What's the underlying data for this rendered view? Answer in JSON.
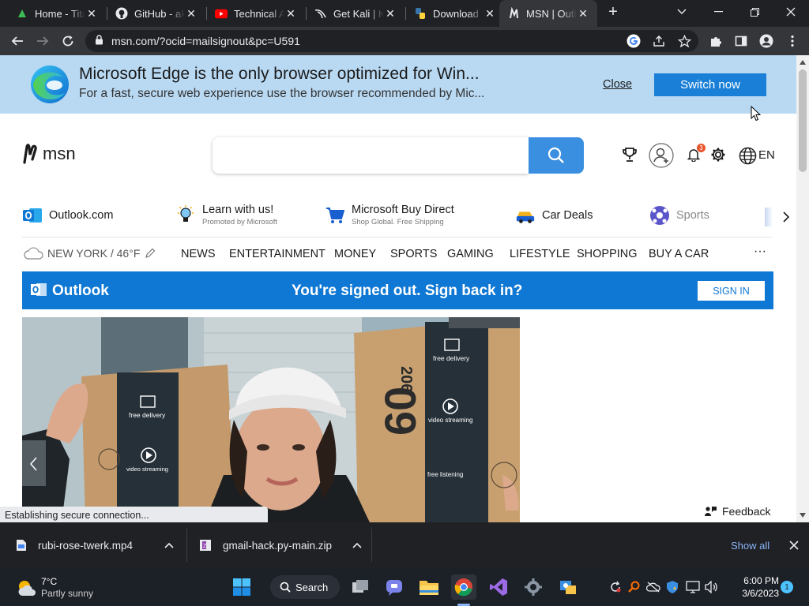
{
  "browser": {
    "tabs": [
      {
        "title": "Home - Tita",
        "icon": "leaf-icon"
      },
      {
        "title": "GitHub - ak",
        "icon": "github-icon"
      },
      {
        "title": "Technical A",
        "icon": "youtube-icon"
      },
      {
        "title": "Get Kali | K",
        "icon": "kali-icon"
      },
      {
        "title": "Download",
        "icon": "python-icon"
      },
      {
        "title": "MSN | Outl",
        "icon": "msn-icon"
      }
    ],
    "url": "msn.com/?ocid=mailsignout&pc=U591"
  },
  "edge_banner": {
    "title": "Microsoft Edge is the only browser optimized for Win...",
    "subtitle": "For a fast, secure web experience use the browser recommended by Mic...",
    "close_label": "Close",
    "switch_label": "Switch now"
  },
  "header": {
    "logo_text": "msn",
    "notification_count": "3",
    "language": "EN"
  },
  "quick_links": [
    {
      "title": "Outlook.com",
      "subtitle": ""
    },
    {
      "title": "Learn with us!",
      "subtitle": "Promoted by Microsoft"
    },
    {
      "title": "Microsoft Buy Direct",
      "subtitle": "Shop Global. Free Shipping"
    },
    {
      "title": "Car Deals",
      "subtitle": ""
    },
    {
      "title": "Sports",
      "subtitle": ""
    }
  ],
  "nav": {
    "weather": "NEW YORK / 46°F",
    "items": [
      "NEWS",
      "ENTERTAINMENT",
      "MONEY",
      "SPORTS",
      "GAMING",
      "LIFESTYLE",
      "SHOPPING",
      "BUY A CAR"
    ],
    "more": "···"
  },
  "outlook_bar": {
    "brand": "Outlook",
    "message": "You're signed out. Sign back in?",
    "signin_label": "SIGN IN"
  },
  "hero": {
    "box_text_1": "free delivery",
    "box_text_2": "video streaming",
    "box_text_3": "free listening",
    "box_number": "60",
    "box_number_2": "206"
  },
  "feedback_label": "Feedback",
  "status_text": "Establishing secure connection...",
  "downloads": {
    "items": [
      "rubi-rose-twerk.mp4",
      "gmail-hack.py-main.zip"
    ],
    "show_all": "Show all"
  },
  "taskbar": {
    "temp": "7°C",
    "weather_desc": "Partly sunny",
    "search_label": "Search",
    "time": "6:00 PM",
    "date": "3/6/2023",
    "notifications": "1"
  }
}
